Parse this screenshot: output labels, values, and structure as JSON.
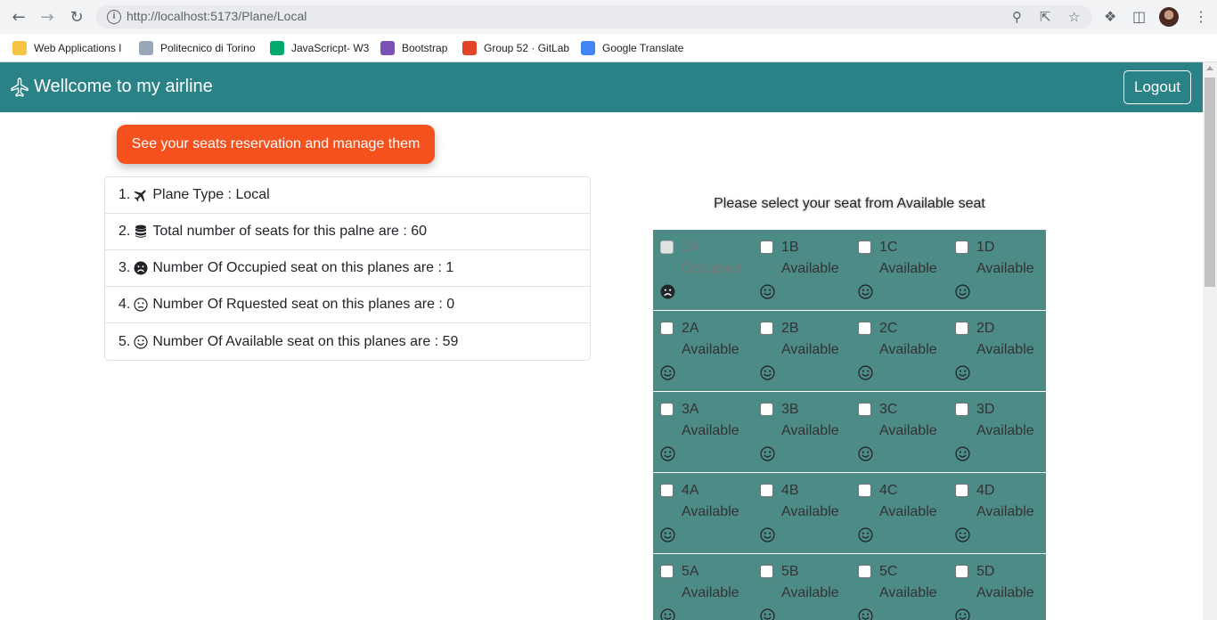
{
  "browser": {
    "url": "http://localhost:5173/Plane/Local",
    "bookmarks": [
      {
        "label": "Web Applications I",
        "color": "#f6c344",
        "icon": "webapp-icon"
      },
      {
        "label": "Politecnico di Torino",
        "color": "#9aa7b8",
        "icon": "polito-icon"
      },
      {
        "label": "JavaScricpt- W3",
        "color": "#04aa6d",
        "icon": "w3-icon"
      },
      {
        "label": "Bootstrap",
        "color": "#7952b3",
        "icon": "bootstrap-icon"
      },
      {
        "label": "Group 52 · GitLab",
        "color": "#e24329",
        "icon": "gitlab-icon"
      },
      {
        "label": "Google Translate",
        "color": "#4285f4",
        "icon": "translate-icon"
      }
    ]
  },
  "navbar": {
    "brand": "Wellcome to my airline",
    "logout_label": "Logout",
    "color": "#2a8286"
  },
  "cta_label": "See your seats reservation and manage them",
  "info_items": [
    {
      "num": "1.",
      "icon": "plane-icon",
      "text": "Plane Type : Local"
    },
    {
      "num": "2.",
      "icon": "database-icon",
      "text": "Total number of seats for this palne are : 60"
    },
    {
      "num": "3.",
      "icon": "frown-icon",
      "text": "Number Of Occupied seat on this planes are : 1"
    },
    {
      "num": "4.",
      "icon": "neutral-face-icon",
      "text": "Number Of Rquested seat on this planes are : 0"
    },
    {
      "num": "5.",
      "icon": "smile-icon",
      "text": "Number Of Available seat on this planes are : 59"
    }
  ],
  "seat_heading": "Please select your seat from Available seat",
  "seat_rows": [
    [
      {
        "id": "1A",
        "status": "Occupied"
      },
      {
        "id": "1B",
        "status": "Available"
      },
      {
        "id": "1C",
        "status": "Available"
      },
      {
        "id": "1D",
        "status": "Available"
      }
    ],
    [
      {
        "id": "2A",
        "status": "Available"
      },
      {
        "id": "2B",
        "status": "Available"
      },
      {
        "id": "2C",
        "status": "Available"
      },
      {
        "id": "2D",
        "status": "Available"
      }
    ],
    [
      {
        "id": "3A",
        "status": "Available"
      },
      {
        "id": "3B",
        "status": "Available"
      },
      {
        "id": "3C",
        "status": "Available"
      },
      {
        "id": "3D",
        "status": "Available"
      }
    ],
    [
      {
        "id": "4A",
        "status": "Available"
      },
      {
        "id": "4B",
        "status": "Available"
      },
      {
        "id": "4C",
        "status": "Available"
      },
      {
        "id": "4D",
        "status": "Available"
      }
    ],
    [
      {
        "id": "5A",
        "status": "Available"
      },
      {
        "id": "5B",
        "status": "Available"
      },
      {
        "id": "5C",
        "status": "Available"
      },
      {
        "id": "5D",
        "status": "Available"
      }
    ]
  ]
}
